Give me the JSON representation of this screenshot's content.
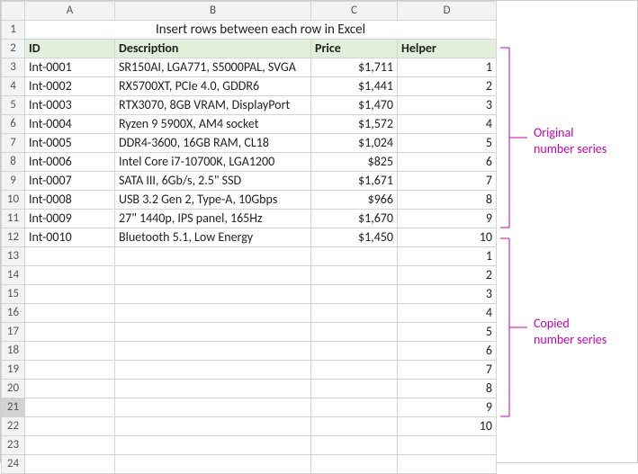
{
  "columns": [
    "A",
    "B",
    "C",
    "D"
  ],
  "title": "Insert rows between each row in Excel",
  "headers": {
    "id": "ID",
    "desc": "Description",
    "price": "Price",
    "helper": "Helper"
  },
  "rows": [
    {
      "id": "Int-0001",
      "desc": "SR150AI, LGA771, S5000PAL, SVGA",
      "price": "$1,711",
      "helper": "1"
    },
    {
      "id": "Int-0002",
      "desc": "RX5700XT, PCIe 4.0, GDDR6",
      "price": "$1,441",
      "helper": "2"
    },
    {
      "id": "Int-0003",
      "desc": "RTX3070, 8GB VRAM, DisplayPort",
      "price": "$1,470",
      "helper": "3"
    },
    {
      "id": "Int-0004",
      "desc": "Ryzen 9 5900X, AM4 socket",
      "price": "$1,572",
      "helper": "4"
    },
    {
      "id": "Int-0005",
      "desc": "DDR4-3600, 16GB RAM, CL18",
      "price": "$1,024",
      "helper": "5"
    },
    {
      "id": "Int-0006",
      "desc": "Intel Core i7-10700K, LGA1200",
      "price": "$825",
      "helper": "6"
    },
    {
      "id": "Int-0007",
      "desc": "SATA III, 6Gb/s, 2.5\" SSD",
      "price": "$1,671",
      "helper": "7"
    },
    {
      "id": "Int-0008",
      "desc": "USB 3.2 Gen 2, Type-A, 10Gbps",
      "price": "$966",
      "helper": "8"
    },
    {
      "id": "Int-0009",
      "desc": "27\" 1440p, IPS panel, 165Hz",
      "price": "$1,670",
      "helper": "9"
    },
    {
      "id": "Int-0010",
      "desc": "Bluetooth 5.1, Low Energy",
      "price": "$1,450",
      "helper": "10"
    }
  ],
  "copied": [
    "1",
    "2",
    "3",
    "4",
    "5",
    "6",
    "7",
    "8",
    "9",
    "10"
  ],
  "annotations": {
    "original": "Original\nnumber series",
    "copied": "Copied\nnumber series"
  },
  "colors": {
    "accent": "#c700b5",
    "headerFill": "#e2efda"
  }
}
